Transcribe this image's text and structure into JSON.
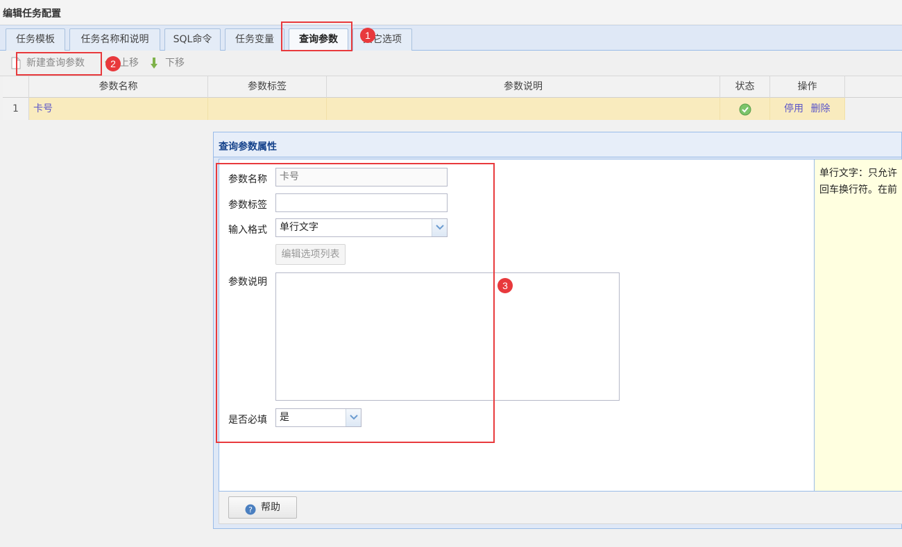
{
  "window": {
    "title": "编辑任务配置"
  },
  "tabs": [
    {
      "label": "任务模板"
    },
    {
      "label": "任务名称和说明"
    },
    {
      "label": "SQL命令"
    },
    {
      "label": "任务变量"
    },
    {
      "label": "查询参数",
      "active": true
    },
    {
      "label": "其它选项"
    }
  ],
  "toolbar": {
    "new_label": "新建查询参数",
    "up_label": "上移",
    "down_label": "下移"
  },
  "grid": {
    "columns": [
      "参数名称",
      "参数标签",
      "参数说明",
      "状态",
      "操作"
    ],
    "rows": [
      {
        "num": "1",
        "name": "卡号",
        "label": "",
        "desc": "",
        "status": "enabled",
        "action_disable": "停用",
        "action_delete": "删除"
      }
    ]
  },
  "panel": {
    "title": "查询参数属性",
    "form": {
      "name_label": "参数名称",
      "name_value": "卡号",
      "tag_label": "参数标签",
      "tag_value": "",
      "format_label": "输入格式",
      "format_value": "单行文字",
      "edit_options_label": "编辑选项列表",
      "desc_label": "参数说明",
      "desc_value": "",
      "required_label": "是否必填",
      "required_value": "是"
    },
    "help_text": [
      "单行文字：只允许",
      "回车换行符。在前"
    ],
    "help_button": "帮助"
  },
  "annotations": [
    "1",
    "2",
    "3"
  ],
  "colors": {
    "accent_red": "#e8393c",
    "selected_row": "#f9ebbe",
    "link": "#5a55c9",
    "help_bg": "#ffffe0"
  }
}
